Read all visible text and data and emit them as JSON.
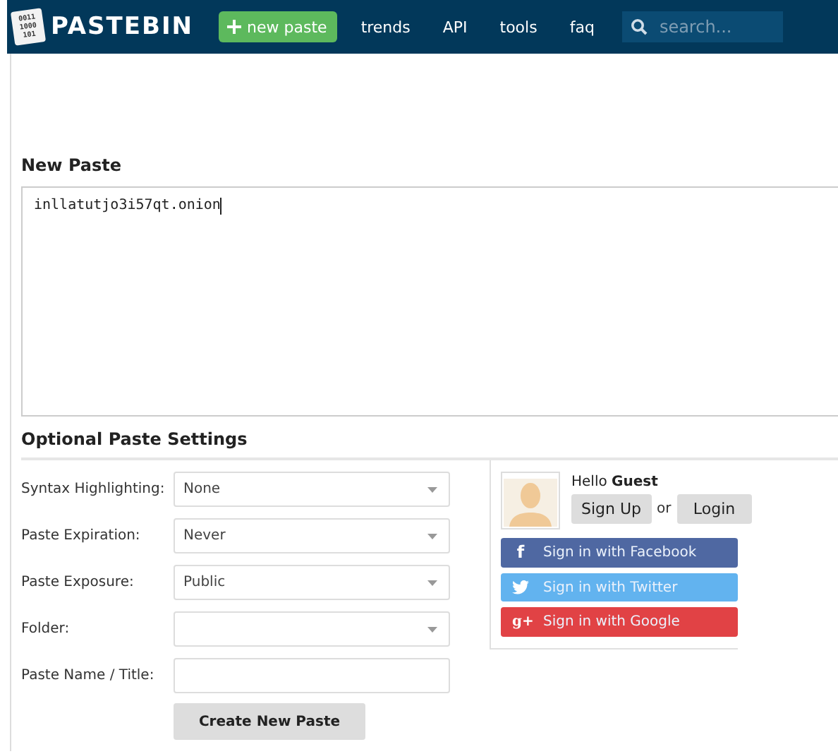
{
  "header": {
    "logo_digits": [
      "0011",
      "1000",
      "101"
    ],
    "brand": "PASTEBIN",
    "new_paste": "new paste",
    "nav": [
      "trends",
      "API",
      "tools",
      "faq"
    ],
    "search": {
      "placeholder": "search..."
    }
  },
  "new_paste": {
    "title": "New Paste",
    "content": "inllatutjo3i57qt.onion"
  },
  "settings": {
    "title": "Optional Paste Settings",
    "fields": [
      {
        "label": "Syntax Highlighting:",
        "kind": "select",
        "value": "None"
      },
      {
        "label": "Paste Expiration:",
        "kind": "select",
        "value": "Never"
      },
      {
        "label": "Paste Exposure:",
        "kind": "select",
        "value": "Public"
      },
      {
        "label": "Folder:",
        "kind": "select"
      },
      {
        "label": "Paste Name / Title:",
        "kind": "text"
      }
    ],
    "submit": "Create New Paste"
  },
  "account": {
    "greeting": "Hello **Guest**",
    "sign_up": "Sign Up",
    "or": "or",
    "login": "Login",
    "social": [
      {
        "kind": "facebook",
        "glyph": "f",
        "label": "Sign in with Facebook",
        "color": "#4f68a2"
      },
      {
        "kind": "twitter",
        "label": "Sign in with Twitter",
        "color": "#62b3ef"
      },
      {
        "kind": "google",
        "glyph": "g+",
        "label": "Sign in with Google",
        "color": "#e14245"
      }
    ]
  }
}
